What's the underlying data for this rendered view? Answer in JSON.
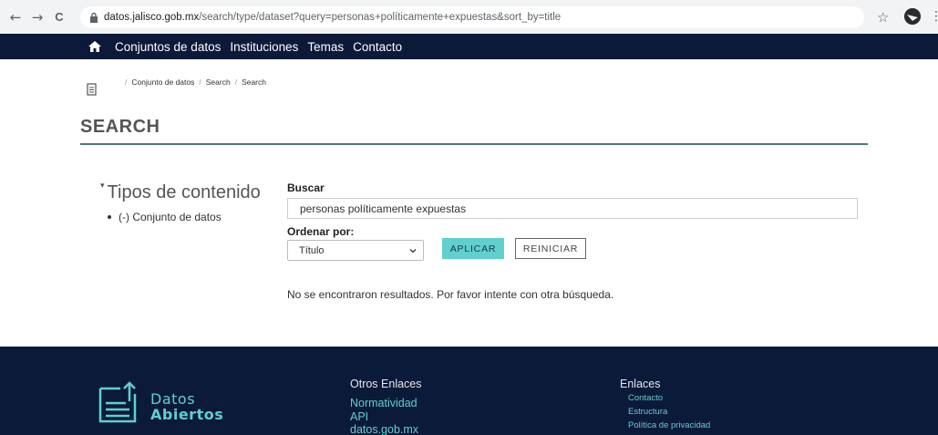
{
  "browser": {
    "url_domain": "datos.jalisco.gob.mx",
    "url_rest": "/search/type/dataset?query=personas+políticamente+expuestas&sort_by=title",
    "back_glyph": "←",
    "forward_glyph": "→",
    "reload_glyph": "C",
    "star_glyph": "☆",
    "menu_glyph": "⋮"
  },
  "navbar": {
    "items": [
      "Conjuntos de datos",
      "Instituciones",
      "Temas",
      "Contacto"
    ]
  },
  "breadcrumb": {
    "items": [
      "Conjunto de datos",
      "Search",
      "Search"
    ],
    "separator": "/"
  },
  "page_title": "SEARCH",
  "facets": {
    "heading": "Tipos de contenido",
    "items": [
      "(-) Conjunto de datos"
    ]
  },
  "search": {
    "buscar_label": "Buscar",
    "query_value": "personas políticamente expuestas",
    "sort_label": "Ordenar por:",
    "sort_selected": "Título",
    "apply_label": "APLICAR",
    "reset_label": "REINICIAR",
    "no_results": "No se encontraron resultados. Por favor intente con otra búsqueda."
  },
  "footer": {
    "logo_line1": "Datos",
    "logo_line2": "Abiertos",
    "col1_heading": "Otros Enlaces",
    "col1_links": [
      "Normatividad",
      "API",
      "datos.gob.mx"
    ],
    "col2_heading": "Enlaces",
    "col2_links": [
      "Contacto",
      "Estructura",
      "Política de privacidad"
    ]
  },
  "colors": {
    "navbar_bg": "#0c1a3a",
    "accent_teal": "#5fd0cc",
    "title_rule": "#4a7a6e"
  }
}
